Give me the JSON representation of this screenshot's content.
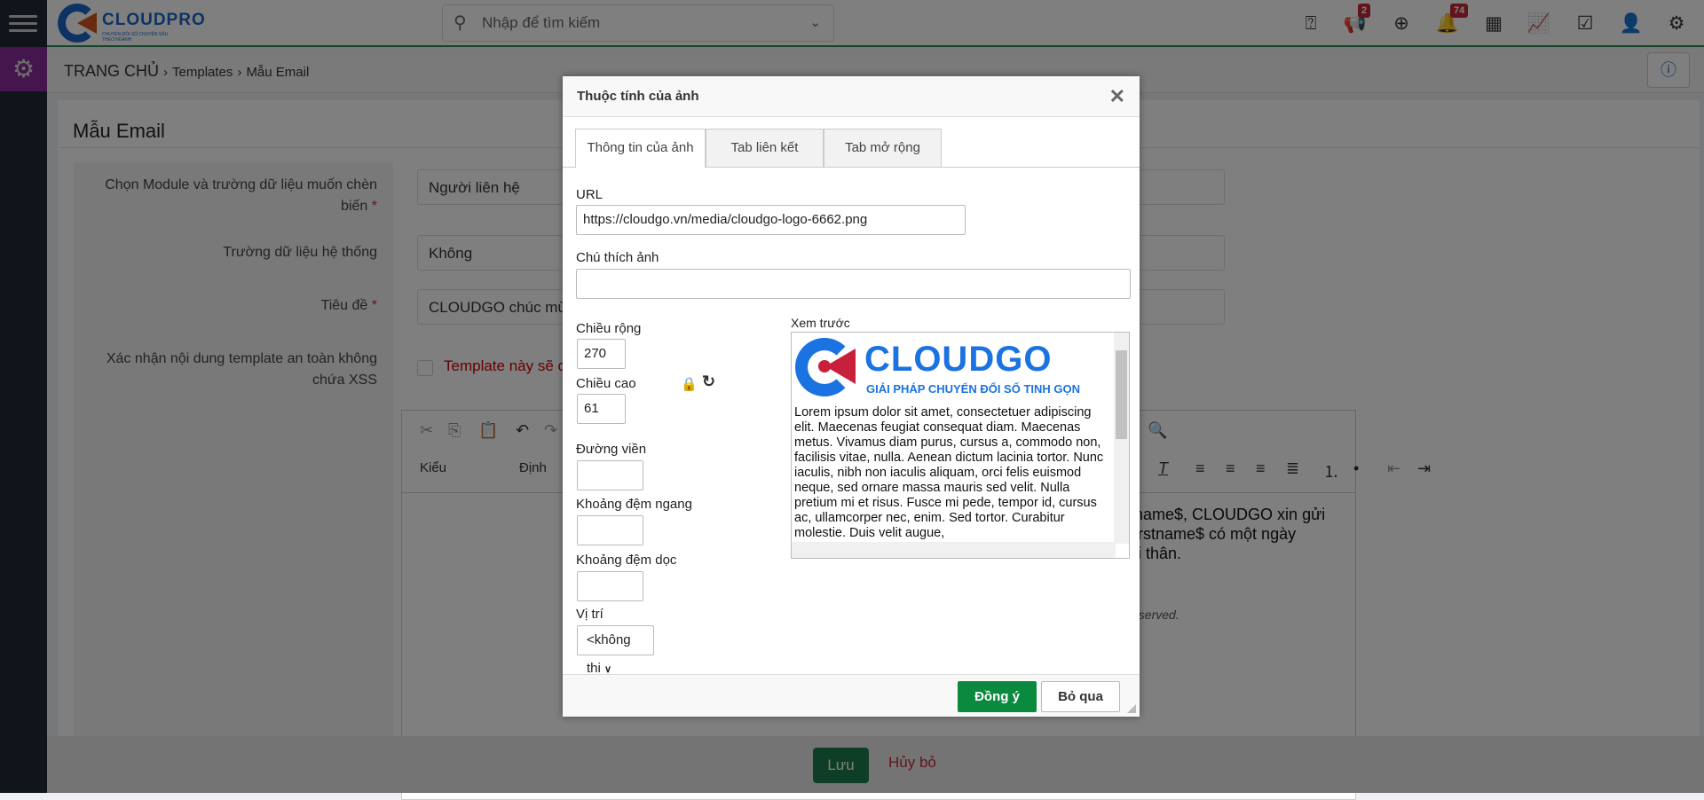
{
  "app": {
    "logo_name": "CLOUDPRO",
    "logo_tagline": "CHUYỂN ĐỔI SỐ CHUYÊN SÂU THEO NGÀNH"
  },
  "header": {
    "search_placeholder": "Nhập để tìm kiếm",
    "announcement_badge": "2",
    "notification_badge": "74",
    "icons": [
      "map-marker-question",
      "megaphone",
      "plus-circle",
      "bell",
      "calendar",
      "chart",
      "checkbox",
      "user",
      "gear"
    ]
  },
  "breadcrumb": {
    "home": "TRANG CHỦ",
    "sep": "›",
    "items": [
      "Templates",
      "Mẫu Email"
    ]
  },
  "page": {
    "title": "Mẫu Email",
    "fields": [
      {
        "label": "Chọn Module và trường dữ liệu muốn chèn biến",
        "required": "*",
        "value": "Người liên hệ"
      },
      {
        "label": "Trường dữ liệu hệ thống",
        "value": "Không"
      },
      {
        "label": "Tiêu đề",
        "required": "*",
        "value": "CLOUDGO chúc mừ"
      },
      {
        "label": "Xác nhận nội dung template an toàn không chứa XSS",
        "value": "Template này sẽ c"
      }
    ],
    "editor": {
      "style_label": "Kiểu",
      "format_label": "Định",
      "line1": "tname$, CLOUDGO xin gửi",
      "line2": "firstname$ có một ngày",
      "line3": "vi thân.",
      "footer_text": "eserved."
    }
  },
  "bottom": {
    "save": "Lưu",
    "cancel": "Hủy bỏ"
  },
  "dialog": {
    "title": "Thuộc tính của ảnh",
    "tabs": [
      {
        "label": "Thông tin của ảnh",
        "active": true
      },
      {
        "label": "Tab liên kết"
      },
      {
        "label": "Tab mở rộng"
      }
    ],
    "url_label": "URL",
    "url_value": "https://cloudgo.vn/media/cloudgo-logo-6662.png",
    "alt_label": "Chú thích ảnh",
    "alt_value": "",
    "width_label": "Chiều rộng",
    "width_value": "270",
    "height_label": "Chiều cao",
    "height_value": "61",
    "border_label": "Đường viền",
    "hspace_label": "Khoảng đệm ngang",
    "vspace_label": "Khoảng đệm dọc",
    "align_label": "Vị trí",
    "align_value": "<không thi",
    "preview_label": "Xem trước",
    "preview_logo_name": "CLOUDGO",
    "preview_logo_tagline": "GIẢI PHÁP CHUYỂN ĐỔI SỐ TINH GỌN",
    "preview_text": "Lorem ipsum dolor sit amet, consectetuer adipiscing elit. Maecenas feugiat consequat diam. Maecenas metus. Vivamus diam purus, cursus a, commodo non, facilisis vitae, nulla. Aenean dictum lacinia tortor. Nunc iaculis, nibh non iaculis aliquam, orci felis euismod neque, sed ornare massa mauris sed velit. Nulla pretium mi et risus. Fusce mi pede, tempor id, cursus ac, ullamcorper nec, enim. Sed tortor. Curabitur molestie. Duis velit augue,",
    "ok": "Đồng ý",
    "cancel": "Bỏ qua"
  },
  "colors": {
    "accent_green": "#098a3e",
    "badge_red": "#c62836",
    "brand_blue": "#1a66c9",
    "brand_red": "#c8203a"
  }
}
